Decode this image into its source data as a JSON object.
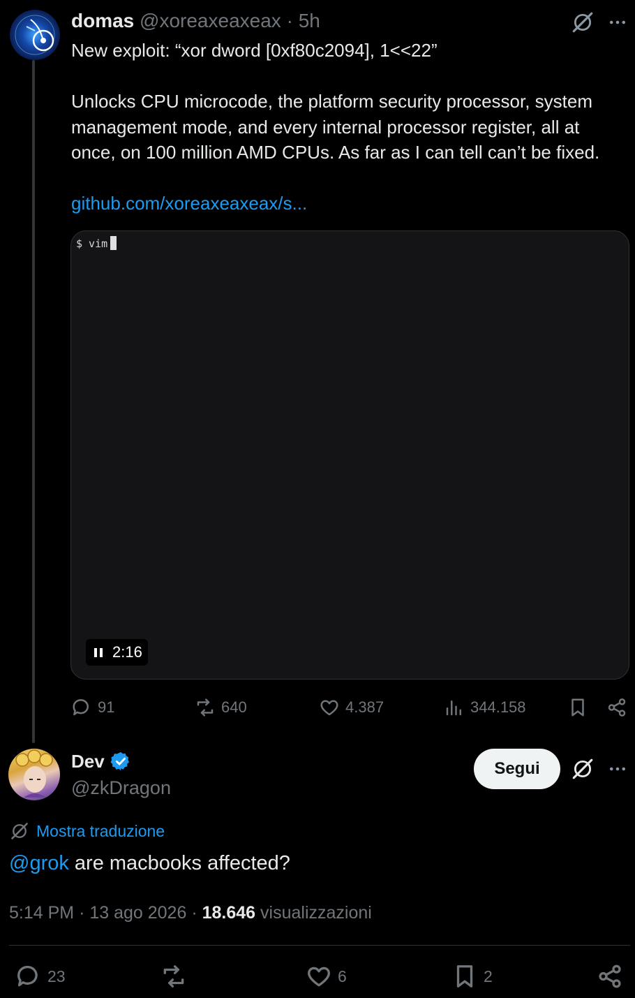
{
  "post": {
    "author": {
      "name": "domas",
      "handle": "@xoreaxeaxeax",
      "separator": "·",
      "time": "5h"
    },
    "text_lines": [
      "New exploit: “xor dword [0xf80c2094], 1<<22”",
      "",
      "Unlocks CPU microcode, the platform security processor, system",
      "management mode, and every internal processor register, all at",
      "once, on 100 million AMD CPUs.  As far as I can tell can’t be fixed.",
      ""
    ],
    "link": "github.com/xoreaxeaxeax/s...",
    "video": {
      "terminal_prompt": "$ vim",
      "duration": "2:16"
    },
    "actions": {
      "replies": "91",
      "reposts": "640",
      "likes": "4.387",
      "views": "344.158"
    }
  },
  "reply": {
    "author": {
      "name": "Dev",
      "handle": "@zkDragon",
      "verified": true
    },
    "follow_label": "Segui",
    "translate_label": "Mostra traduzione",
    "mention": "@grok",
    "text": " are macbooks affected?",
    "meta": {
      "time": "5:14 PM",
      "date": "13 ago 2026",
      "separator": "·",
      "views_count": "18.646",
      "views_label": "visualizzazioni"
    },
    "actions": {
      "replies": "23",
      "likes": "6",
      "bookmarks": "2"
    }
  },
  "icons": {
    "grok": "grok-icon",
    "more": "more-icon",
    "reply": "reply-icon",
    "repost": "repost-icon",
    "like": "heart-icon",
    "views": "views-icon",
    "bookmark": "bookmark-icon",
    "share": "share-icon",
    "verified": "verified-badge-icon",
    "pause": "pause-icon",
    "translate": "translate-icon"
  },
  "colors": {
    "background": "#000000",
    "text": "#e7e9ea",
    "muted": "#71767b",
    "link": "#1d9bf0",
    "verified": "#1d9bf0",
    "follow_bg": "#eff3f4"
  }
}
